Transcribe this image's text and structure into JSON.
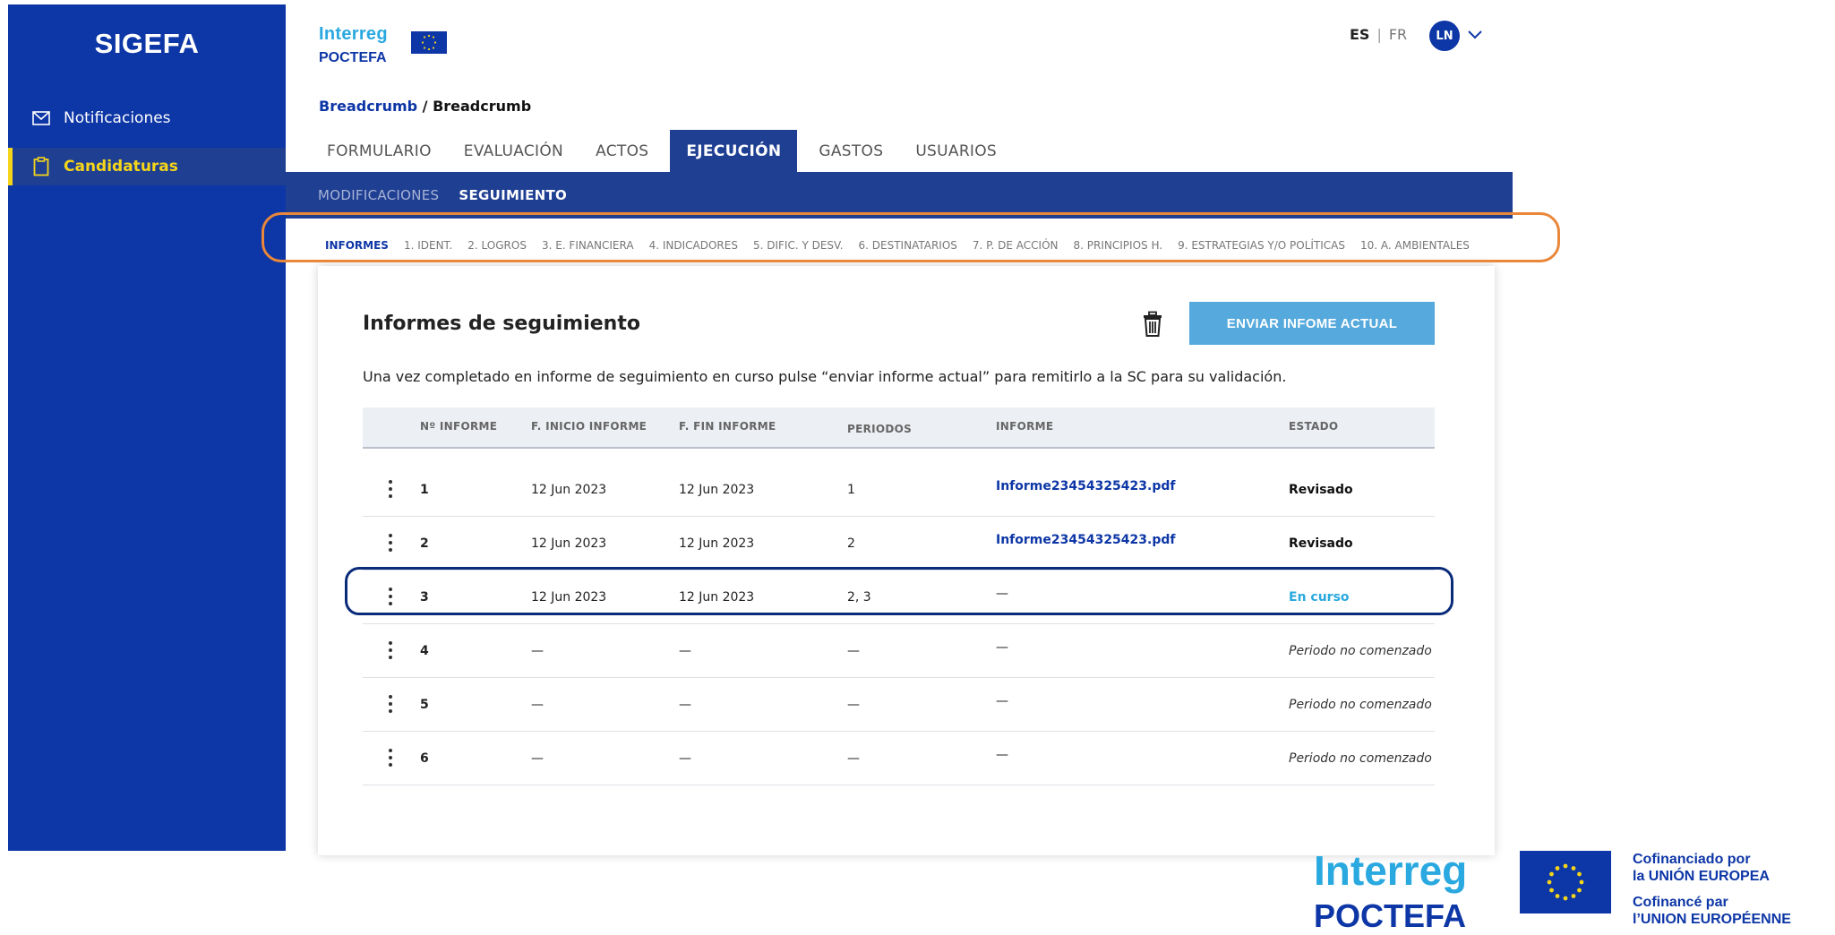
{
  "sidebar": {
    "brand": "SIGEFA",
    "items": [
      {
        "label": "Notificaciones",
        "icon": "mail-icon"
      },
      {
        "label": "Candidaturas",
        "icon": "clipboard-icon",
        "active": true
      }
    ]
  },
  "header": {
    "logo": {
      "interreg": "Interreg",
      "poctefa": "POCTEFA"
    },
    "lang": {
      "es": "ES",
      "separator": "|",
      "fr": "FR"
    },
    "user_initials": "LN",
    "breadcrumb": {
      "link": "Breadcrumb",
      "separator": " / ",
      "current": "Breadcrumb"
    }
  },
  "tabs": [
    "FORMULARIO",
    "EVALUACIÓN",
    "ACTOS",
    "EJECUCIÓN",
    "GASTOS",
    "USUARIOS"
  ],
  "active_tab": "EJECUCIÓN",
  "subnav": [
    "MODIFICACIONES",
    "SEGUIMIENTO"
  ],
  "active_subnav": "SEGUIMIENTO",
  "steps": [
    "INFORMES",
    "1. IDENT.",
    "2. LOGROS",
    "3. E. FINANCIERA",
    "4. INDICADORES",
    "5. DIFIC. Y DESV.",
    "6. DESTINATARIOS",
    "7. P. DE ACCIÓN",
    "8. PRINCIPIOS H.",
    "9. ESTRATEGIAS Y/O POLÍTICAS",
    "10. A. AMBIENTALES"
  ],
  "active_step": "INFORMES",
  "card": {
    "title": "Informes de seguimiento",
    "send_button": "ENVIAR INFOME ACTUAL",
    "description": "Una vez completado en informe de seguimiento en curso pulse “enviar informe actual” para remitirlo a la SC para su validación.",
    "columns": [
      "Nº INFORME",
      "F. INICIO INFORME",
      "F. FIN INFORME",
      "PERIODOS",
      "INFORME",
      "ESTADO"
    ],
    "rows": [
      {
        "num": "1",
        "inicio": "12 Jun 2023",
        "fin": "12 Jun 2023",
        "periodos": "1",
        "informe": "Informe23454325423.pdf",
        "estado": "Revisado",
        "estado_style": "bold"
      },
      {
        "num": "2",
        "inicio": "12 Jun 2023",
        "fin": "12 Jun 2023",
        "periodos": "2",
        "informe": "Informe23454325423.pdf",
        "estado": "Revisado",
        "estado_style": "bold"
      },
      {
        "num": "3",
        "inicio": "12 Jun 2023",
        "fin": "12 Jun 2023",
        "periodos": "2, 3",
        "informe": "—",
        "estado": "En curso",
        "estado_style": "curso"
      },
      {
        "num": "4",
        "inicio": "—",
        "fin": "—",
        "periodos": "—",
        "informe": "—",
        "estado": "Periodo no comenzado",
        "estado_style": "italic"
      },
      {
        "num": "5",
        "inicio": "—",
        "fin": "—",
        "periodos": "—",
        "informe": "—",
        "estado": "Periodo no comenzado",
        "estado_style": "italic"
      },
      {
        "num": "6",
        "inicio": "—",
        "fin": "—",
        "periodos": "—",
        "informe": "—",
        "estado": "Periodo no comenzado",
        "estado_style": "italic"
      }
    ]
  },
  "footer": {
    "interreg": "Interreg",
    "poctefa": "POCTEFA",
    "cof_es_1": "Cofinanciado por",
    "cof_es_2": "la UNIÓN EUROPEA",
    "cof_fr_1": "Cofinancé par",
    "cof_fr_2": "l’UNION EUROPÉENNE"
  },
  "colors": {
    "primary": "#0d36a6",
    "secondary": "#1f3f93",
    "accent_yellow": "#f5d519",
    "accent_light_blue": "#55a9dc",
    "link_blue": "#2aa9e0",
    "orange_mark": "#e9873a",
    "dark_mark": "#0a2a7a"
  }
}
